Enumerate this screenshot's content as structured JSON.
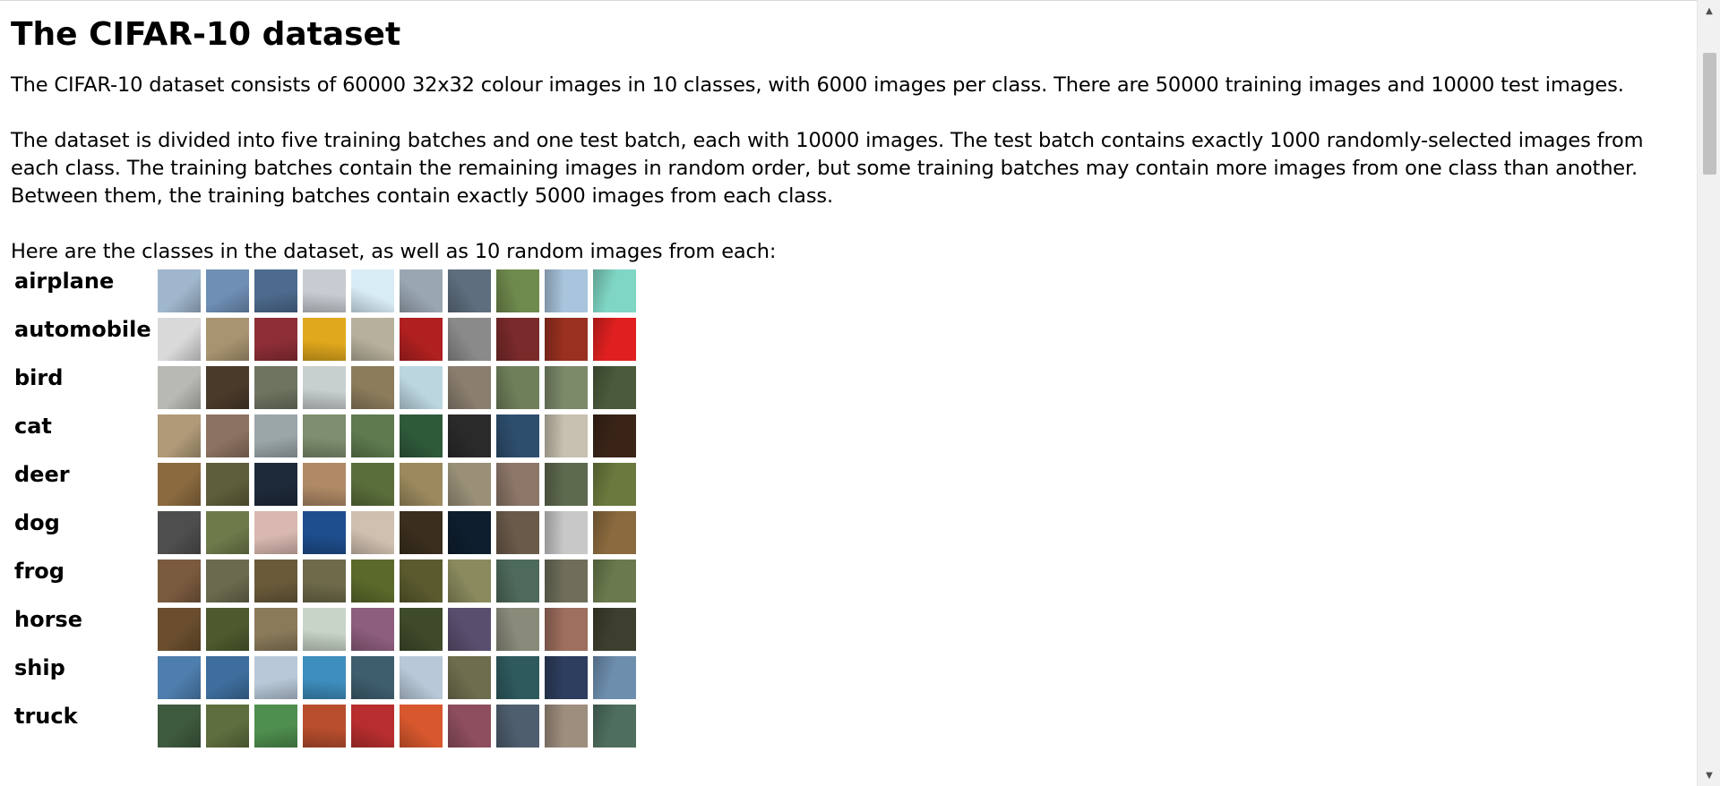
{
  "page": {
    "title": "The CIFAR-10 dataset",
    "paragraphs": [
      "The CIFAR-10 dataset consists of 60000 32x32 colour images in 10 classes, with 6000 images per class. There are 50000 training images and 10000 test images.",
      "The dataset is divided into five training batches and one test batch, each with 10000 images. The test batch contains exactly 1000 randomly-selected images from each class. The training batches contain the remaining images in random order, but some training batches may contain more images from one class than another. Between them, the training batches contain exactly 5000 images from each class.",
      "Here are the classes in the dataset, as well as 10 random images from each:"
    ]
  },
  "classes": [
    {
      "name": "airplane",
      "thumbs": [
        "#9fb6cc",
        "#6f8fb5",
        "#4d6b8e",
        "#c8ccd2",
        "#d8ecf6",
        "#9aa7b3",
        "#5e6e7e",
        "#6f8a4d",
        "#a9c4dd",
        "#7fd6c4"
      ]
    },
    {
      "name": "automobile",
      "thumbs": [
        "#d9d9d9",
        "#a89470",
        "#8e2e36",
        "#e0a81c",
        "#b7b09c",
        "#b02020",
        "#8a8a8a",
        "#7a2a2a",
        "#9a3020",
        "#e02020"
      ]
    },
    {
      "name": "bird",
      "thumbs": [
        "#b8b8b4",
        "#4a3a2a",
        "#6e7460",
        "#c8cfcf",
        "#8c7c5c",
        "#bcd6e0",
        "#8a7e6e",
        "#6f7f5a",
        "#7c8a6a",
        "#4a5a3a"
      ]
    },
    {
      "name": "cat",
      "thumbs": [
        "#b09a78",
        "#8c7260",
        "#9aa6a8",
        "#7e8e6e",
        "#5e7a4e",
        "#2f5a3a",
        "#2a2a2a",
        "#2e4e6e",
        "#c8c0b0",
        "#3a2418"
      ]
    },
    {
      "name": "deer",
      "thumbs": [
        "#8a6a3e",
        "#5e5e3a",
        "#1e2a3a",
        "#b08a66",
        "#5a6e3a",
        "#9c8a5e",
        "#9a9078",
        "#8c7668",
        "#5e6a4e",
        "#6a7a3e"
      ]
    },
    {
      "name": "dog",
      "thumbs": [
        "#4e4e4e",
        "#6e7a4a",
        "#d8b8b0",
        "#1e4e8e",
        "#d0c0b0",
        "#3a2e1e",
        "#0e1e2e",
        "#6a5a4a",
        "#c8c8c8",
        "#8a6a3e"
      ]
    },
    {
      "name": "frog",
      "thumbs": [
        "#7a5a3e",
        "#6a6a4e",
        "#6a5a3a",
        "#6e6a4a",
        "#5a6a2a",
        "#5a5a2e",
        "#8a8a5e",
        "#4e6a5a",
        "#6e6e5a",
        "#6a7a4e"
      ]
    },
    {
      "name": "horse",
      "thumbs": [
        "#6a4e2e",
        "#4e5a2e",
        "#8a7a5a",
        "#c8d4c8",
        "#8e5e7e",
        "#3e4a2a",
        "#5a4e6e",
        "#8a8a7a",
        "#9e6e5e",
        "#3e3e2e"
      ]
    },
    {
      "name": "ship",
      "thumbs": [
        "#4e7eae",
        "#3e6e9e",
        "#b8c8d8",
        "#3e8ebe",
        "#3e5e6e",
        "#b8c8d8",
        "#6e6e4e",
        "#2e5a5e",
        "#2e3e5e",
        "#6e8eae"
      ]
    },
    {
      "name": "truck",
      "thumbs": [
        "#3e5a3e",
        "#5e6e3e",
        "#4e8e4e",
        "#b84e2e",
        "#b82e2e",
        "#d8582e",
        "#8e4e5e",
        "#4e5e6e",
        "#9e8e7e",
        "#4e6e5e"
      ]
    }
  ],
  "scrollbar": {
    "up_arrow": "▲",
    "down_arrow": "▼",
    "position": 0.05
  }
}
